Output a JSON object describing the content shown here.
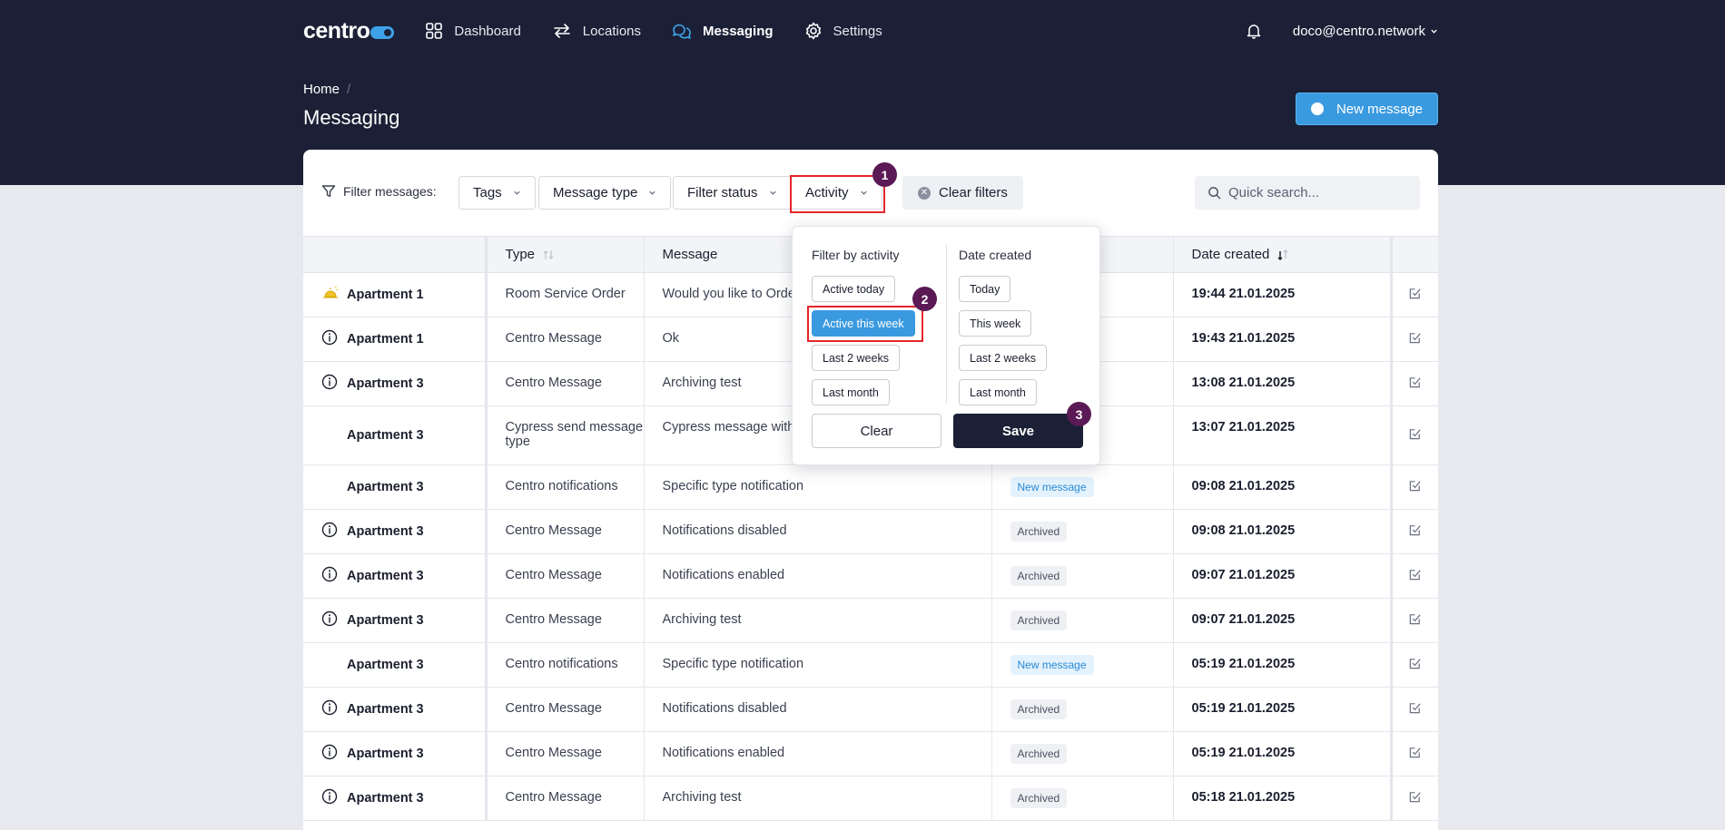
{
  "app": {
    "logo": "centro",
    "nav": [
      {
        "label": "Dashboard",
        "icon": "grid-icon"
      },
      {
        "label": "Locations",
        "icon": "arrows-icon"
      },
      {
        "label": "Messaging",
        "icon": "chat-icon",
        "active": true
      },
      {
        "label": "Settings",
        "icon": "gear-icon"
      }
    ],
    "user": "doco@centro.network"
  },
  "breadcrumb": {
    "home": "Home",
    "separator": "/"
  },
  "page_title": "Messaging",
  "new_message_label": "New message",
  "filters": {
    "label": "Filter messages:",
    "tags": "Tags",
    "message_type": "Message type",
    "filter_status": "Filter status",
    "activity": "Activity",
    "clear_filters": "Clear filters",
    "search_placeholder": "Quick search..."
  },
  "table": {
    "headers": {
      "type": "Type",
      "message": "Message",
      "date_created": "Date created"
    },
    "rows": [
      {
        "icon": "bell-icon",
        "location": "Apartment 1",
        "type": "Room Service Order",
        "message": "Would you like to Order...",
        "status": "",
        "date": "19:44 21.01.2025"
      },
      {
        "icon": "info-icon",
        "location": "Apartment 1",
        "type": "Centro Message",
        "message": "Ok",
        "status": "",
        "date": "19:43 21.01.2025"
      },
      {
        "icon": "info-icon",
        "location": "Apartment 3",
        "type": "Centro Message",
        "message": "Archiving test",
        "status": "",
        "date": "13:08 21.01.2025"
      },
      {
        "icon": "",
        "location": "Apartment 3",
        "type": "Cypress send message type",
        "message": "Cypress message with...",
        "status": "",
        "date": "13:07 21.01.2025"
      },
      {
        "icon": "",
        "location": "Apartment 3",
        "type": "Centro notifications",
        "message": "Specific type notification",
        "status": "New message",
        "date": "09:08 21.01.2025"
      },
      {
        "icon": "info-icon",
        "location": "Apartment 3",
        "type": "Centro Message",
        "message": "Notifications disabled",
        "status": "Archived",
        "date": "09:08 21.01.2025"
      },
      {
        "icon": "info-icon",
        "location": "Apartment 3",
        "type": "Centro Message",
        "message": "Notifications enabled",
        "status": "Archived",
        "date": "09:07 21.01.2025"
      },
      {
        "icon": "info-icon",
        "location": "Apartment 3",
        "type": "Centro Message",
        "message": "Archiving test",
        "status": "Archived",
        "date": "09:07 21.01.2025"
      },
      {
        "icon": "",
        "location": "Apartment 3",
        "type": "Centro notifications",
        "message": "Specific type notification",
        "status": "New message",
        "date": "05:19 21.01.2025"
      },
      {
        "icon": "info-icon",
        "location": "Apartment 3",
        "type": "Centro Message",
        "message": "Notifications disabled",
        "status": "Archived",
        "date": "05:19 21.01.2025"
      },
      {
        "icon": "info-icon",
        "location": "Apartment 3",
        "type": "Centro Message",
        "message": "Notifications enabled",
        "status": "Archived",
        "date": "05:19 21.01.2025"
      },
      {
        "icon": "info-icon",
        "location": "Apartment 3",
        "type": "Centro Message",
        "message": "Archiving test",
        "status": "Archived",
        "date": "05:18 21.01.2025"
      }
    ]
  },
  "activity_dropdown": {
    "activity_title": "Filter by activity",
    "activity_options": [
      "Active today",
      "Active this week",
      "Last 2 weeks",
      "Last month"
    ],
    "activity_selected": "Active this week",
    "date_title": "Date created",
    "date_options": [
      "Today",
      "This week",
      "Last 2 weeks",
      "Last month"
    ],
    "clear_label": "Clear",
    "save_label": "Save"
  },
  "annotations": {
    "step1": "1",
    "step2": "2",
    "step3": "3"
  },
  "colors": {
    "header_bg": "#1b2036",
    "accent": "#3a9ae0",
    "highlight": "#e4252b",
    "step_badge": "#5b1a55"
  }
}
